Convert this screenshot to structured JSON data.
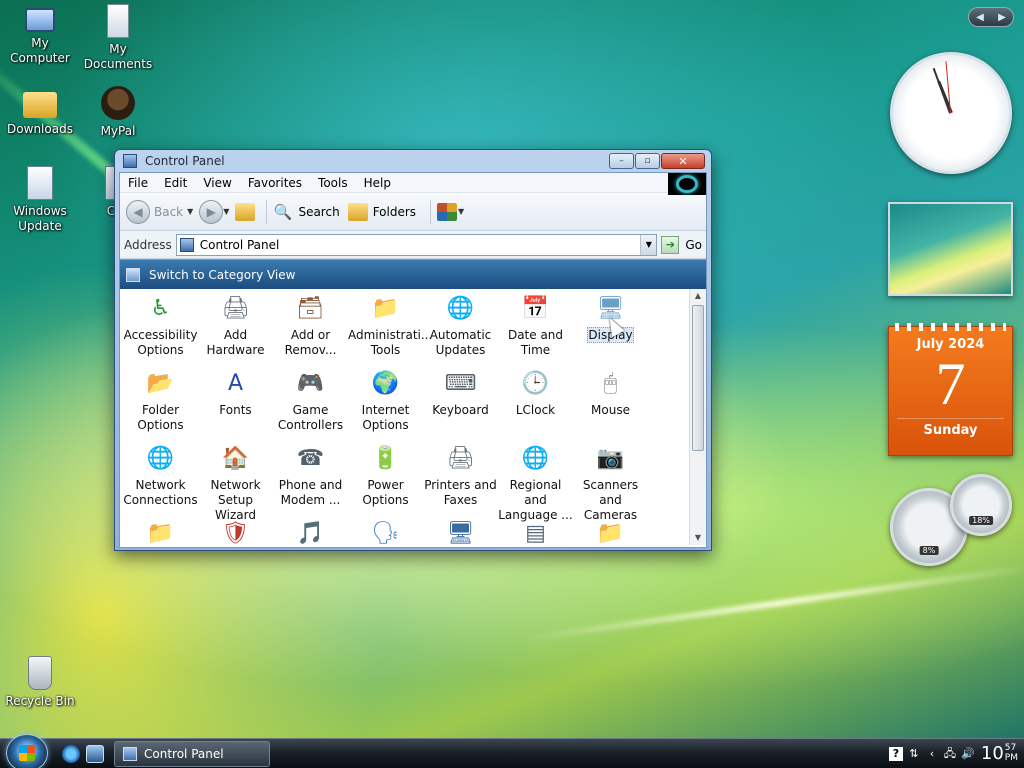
{
  "desktop": {
    "icons": [
      {
        "label": "My Computer",
        "icon": "computer-icon"
      },
      {
        "label": "My Documents",
        "icon": "documents-icon"
      },
      {
        "label": "Downloads",
        "icon": "downloads-folder-icon"
      },
      {
        "label": "MyPal",
        "icon": "mypal-browser-icon"
      },
      {
        "label": "Windows Update",
        "icon": "windows-update-icon"
      },
      {
        "label": "Coll",
        "icon": "collection-icon"
      },
      {
        "label": "Recycle Bin",
        "icon": "recycle-bin-icon"
      }
    ]
  },
  "window": {
    "title": "Control Panel",
    "buttons": {
      "minimize": "–",
      "maximize": "▫",
      "close": "✕"
    },
    "menu": [
      "File",
      "Edit",
      "View",
      "Favorites",
      "Tools",
      "Help"
    ],
    "toolbar": {
      "back": "Back",
      "search": "Search",
      "folders": "Folders"
    },
    "address": {
      "label": "Address",
      "value": "Control Panel",
      "go": "Go"
    },
    "category_link": "Switch to Category View",
    "items": [
      {
        "name": "Accessibility Options",
        "icon": "accessibility-icon",
        "glyph": "♿",
        "color": "#2a9a3a"
      },
      {
        "name": "Add Hardware",
        "icon": "add-hardware-icon",
        "glyph": "🖨",
        "color": "#6a7580"
      },
      {
        "name": "Add or Remov...",
        "icon": "add-remove-programs-icon",
        "glyph": "🗃",
        "color": "#8a5a3a"
      },
      {
        "name": "Administrati... Tools",
        "icon": "admin-tools-icon",
        "glyph": "📁",
        "color": "#c9a03a"
      },
      {
        "name": "Automatic Updates",
        "icon": "automatic-updates-icon",
        "glyph": "🌐",
        "color": "#2a7ac9"
      },
      {
        "name": "Date and Time",
        "icon": "date-time-icon",
        "glyph": "📅",
        "color": "#4a7ab0"
      },
      {
        "name": "Display",
        "icon": "display-icon",
        "glyph": "🖥",
        "color": "#6aa0c8",
        "selected": true
      },
      {
        "name": "Folder Options",
        "icon": "folder-options-icon",
        "glyph": "📂",
        "color": "#d9b440"
      },
      {
        "name": "Fonts",
        "icon": "fonts-icon",
        "glyph": "A",
        "color": "#2a4aa8"
      },
      {
        "name": "Game Controllers",
        "icon": "game-controller-icon",
        "glyph": "🎮",
        "color": "#44505a"
      },
      {
        "name": "Internet Options",
        "icon": "internet-options-icon",
        "glyph": "🌍",
        "color": "#2a8ad0"
      },
      {
        "name": "Keyboard",
        "icon": "keyboard-icon",
        "glyph": "⌨",
        "color": "#555f68"
      },
      {
        "name": "LClock",
        "icon": "lclock-icon",
        "glyph": "🕒",
        "color": "#b8781a"
      },
      {
        "name": "Mouse",
        "icon": "mouse-icon",
        "glyph": "🖱",
        "color": "#707880"
      },
      {
        "name": "Network Connections",
        "icon": "network-connections-icon",
        "glyph": "🌐",
        "color": "#2a8a5a"
      },
      {
        "name": "Network Setup Wizard",
        "icon": "network-setup-wizard-icon",
        "glyph": "🏠",
        "color": "#c0502a"
      },
      {
        "name": "Phone and Modem ...",
        "icon": "phone-modem-icon",
        "glyph": "☎",
        "color": "#55606a"
      },
      {
        "name": "Power Options",
        "icon": "power-options-icon",
        "glyph": "🔋",
        "color": "#3a9a3a"
      },
      {
        "name": "Printers and Faxes",
        "icon": "printers-faxes-icon",
        "glyph": "🖨",
        "color": "#6a7480"
      },
      {
        "name": "Regional and Language ...",
        "icon": "regional-language-icon",
        "glyph": "🌐",
        "color": "#2a7ac0"
      },
      {
        "name": "Scanners and Cameras",
        "icon": "scanners-cameras-icon",
        "glyph": "📷",
        "color": "#6a6a6a"
      },
      {
        "name": "",
        "icon": "scheduled-tasks-icon",
        "glyph": "📁",
        "color": "#c9a03a"
      },
      {
        "name": "",
        "icon": "security-center-icon",
        "glyph": "🛡",
        "color": "#c03a2a"
      },
      {
        "name": "",
        "icon": "sounds-audio-icon",
        "glyph": "🎵",
        "color": "#55606a"
      },
      {
        "name": "",
        "icon": "speech-icon",
        "glyph": "🗣",
        "color": "#3a7ac0"
      },
      {
        "name": "",
        "icon": "system-icon",
        "glyph": "🖥",
        "color": "#3a6aa0"
      },
      {
        "name": "",
        "icon": "taskbar-start-menu-icon",
        "glyph": "▤",
        "color": "#5a6a7a"
      },
      {
        "name": "",
        "icon": "user-accounts-icon",
        "glyph": "📁",
        "color": "#c9a03a"
      }
    ]
  },
  "gadgets": {
    "calendar": {
      "month": "July 2024",
      "day": "7",
      "weekday": "Sunday"
    },
    "cpu_meter": {
      "cpu": "8%",
      "memory": "18%"
    }
  },
  "taskbar": {
    "task": "Control Panel",
    "time_hour": "10",
    "time_min": "57",
    "time_ampm": "PM"
  },
  "colors": {
    "window_blue": "#8fb0d8",
    "category_bar": "#1b4d80",
    "calendar_orange": "#e8651a"
  }
}
